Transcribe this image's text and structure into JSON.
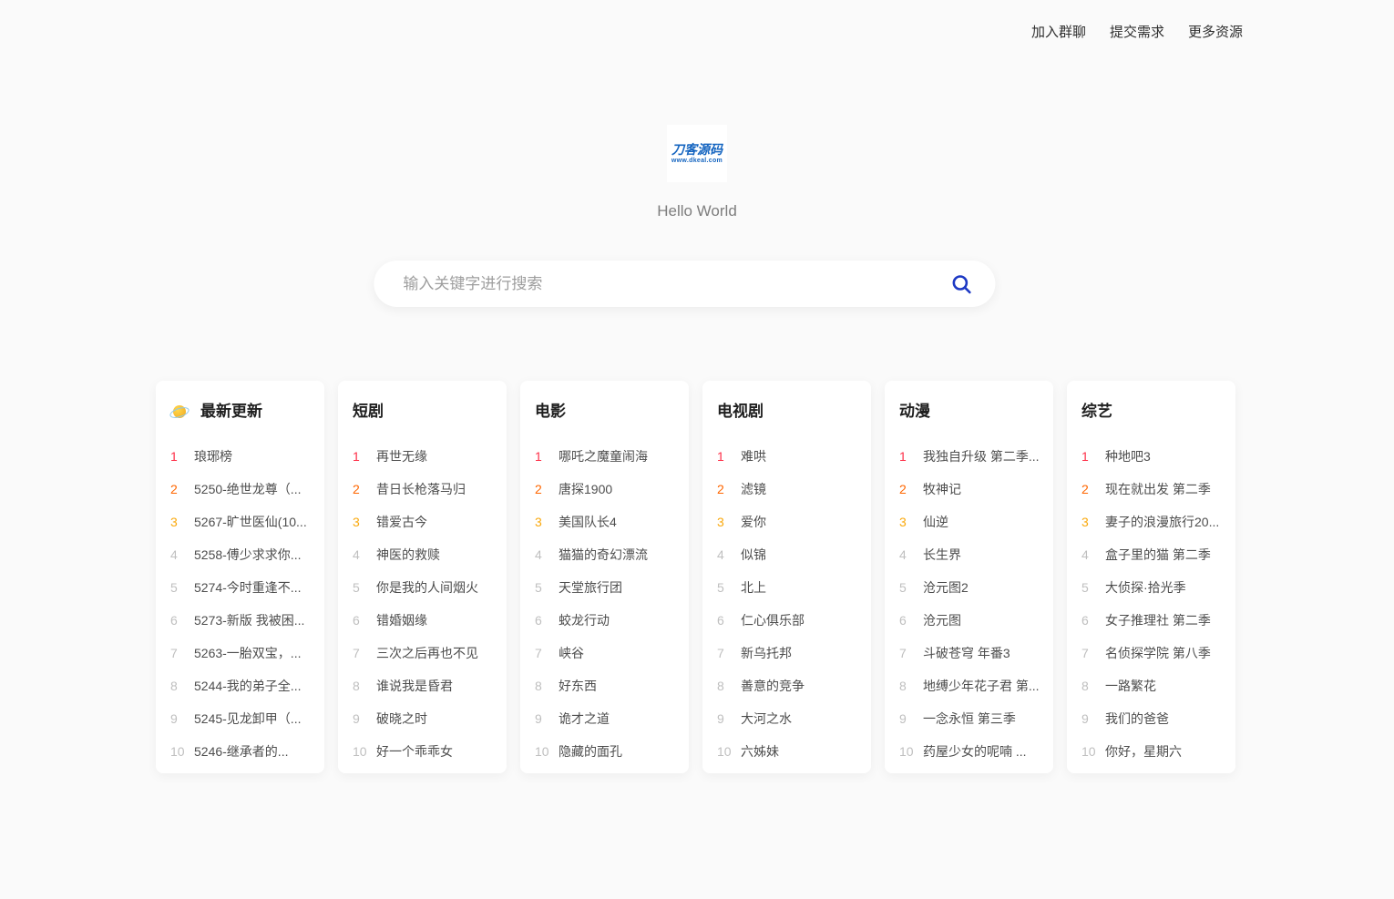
{
  "nav": {
    "items": [
      {
        "label": "加入群聊"
      },
      {
        "label": "提交需求"
      },
      {
        "label": "更多资源"
      }
    ]
  },
  "logo": {
    "title": "刀客源码",
    "url_text": "www.dkeal.com",
    "color": "#1565c0"
  },
  "tagline": "Hello World",
  "search": {
    "placeholder": "输入关键字进行搜索",
    "icon": "search-icon",
    "icon_color": "#1d39c4"
  },
  "rank_colors": {
    "1": "#fe2d46",
    "2": "#ff6600",
    "3": "#faa90e",
    "default": "#bfbfbf"
  },
  "cards": [
    {
      "title": "最新更新",
      "icon": "planet-icon",
      "items": [
        "琅琊榜",
        "5250-绝世龙尊（...",
        "5267-旷世医仙(10...",
        "5258-傅少求求你...",
        "5274-今时重逢不...",
        "5273-新版 我被困...",
        "5263-一胎双宝，...",
        "5244-我的弟子全...",
        "5245-见龙卸甲（...",
        "5246-继承者的..."
      ]
    },
    {
      "title": "短剧",
      "items": [
        "再世无缘",
        "昔日长枪落马归",
        "错爱古今",
        "神医的救赎",
        "你是我的人间烟火",
        "错婚姻缘",
        "三次之后再也不见",
        "谁说我是昏君",
        "破晓之时",
        "好一个乖乖女"
      ]
    },
    {
      "title": "电影",
      "items": [
        "哪吒之魔童闹海",
        "唐探1900",
        "美国队长4",
        "猫猫的奇幻漂流",
        "天堂旅行团",
        "蛟龙行动",
        "峡谷",
        "好东西",
        "诡才之道",
        "隐藏的面孔"
      ]
    },
    {
      "title": "电视剧",
      "items": [
        "难哄",
        "滤镜",
        "爱你",
        "似锦",
        "北上",
        "仁心俱乐部",
        "新乌托邦",
        "善意的竞争",
        "大河之水",
        "六姊妹"
      ]
    },
    {
      "title": "动漫",
      "items": [
        "我独自升级 第二季...",
        "牧神记",
        "仙逆",
        "长生界",
        "沧元图2",
        "沧元图",
        "斗破苍穹 年番3",
        "地缚少年花子君 第...",
        "一念永恒 第三季",
        "药屋少女的呢喃 ..."
      ]
    },
    {
      "title": "综艺",
      "items": [
        "种地吧3",
        "现在就出发 第二季",
        "妻子的浪漫旅行20...",
        "盒子里的猫 第二季",
        "大侦探·拾光季",
        "女子推理社 第二季",
        "名侦探学院 第八季",
        "一路繁花",
        "我们的爸爸",
        "你好，星期六"
      ]
    }
  ]
}
